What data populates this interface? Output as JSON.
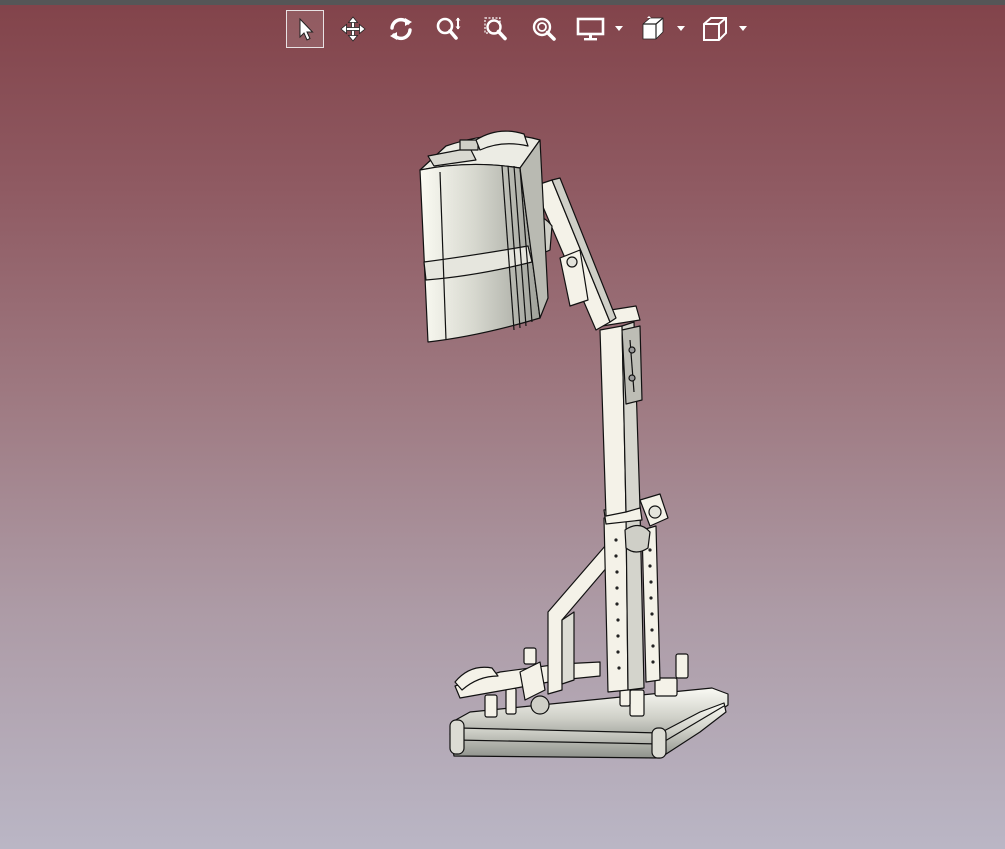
{
  "window": {
    "viewport_label": ""
  },
  "toolbar": {
    "tools": [
      {
        "name": "select-tool",
        "icon": "pointer-arrow-icon",
        "active": true
      },
      {
        "name": "pan-tool",
        "icon": "move-arrows-icon",
        "active": false
      },
      {
        "name": "rotate-tool",
        "icon": "rotate-icon",
        "active": false
      },
      {
        "name": "zoom-tool",
        "icon": "zoom-icon",
        "active": false
      },
      {
        "name": "zoom-window-tool",
        "icon": "zoom-window-icon",
        "active": false
      },
      {
        "name": "fit-all-tool",
        "icon": "zoom-fit-icon",
        "active": false
      },
      {
        "name": "display-mode-tool",
        "icon": "monitor-icon",
        "active": false,
        "has_menu": true
      },
      {
        "name": "render-style-tool",
        "icon": "shaded-cube-icon",
        "active": false,
        "has_menu": true
      },
      {
        "name": "view-orientation-tool",
        "icon": "wire-cube-icon",
        "active": false,
        "has_menu": true
      }
    ]
  },
  "colors": {
    "bg_top": "#82434a",
    "bg_bottom": "#bab6c5",
    "model_fill": "#f4f2e8",
    "model_edge": "#111111",
    "icon": "#ffffff"
  }
}
